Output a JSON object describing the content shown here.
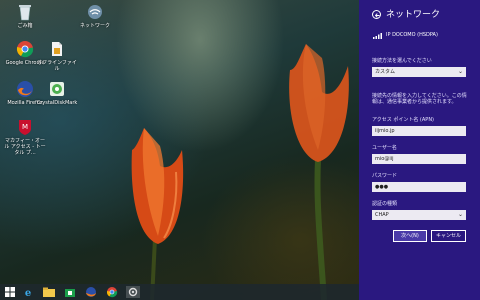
{
  "desktop": {
    "icons": [
      {
        "label": "ごみ箱",
        "icon": "recycle-bin-icon"
      },
      {
        "label": "Google Chrome",
        "icon": "chrome-icon"
      },
      {
        "label": "Mozilla Firefox",
        "icon": "firefox-icon"
      },
      {
        "label": "マカフィー・オール アクセス - トータル プ...",
        "icon": "mcafee-icon"
      },
      {
        "label": "ネットワーク",
        "icon": "network-icon"
      },
      {
        "label": "オフラインファイル",
        "icon": "offline-file-icon"
      },
      {
        "label": "CrystalDiskMark",
        "icon": "crystaldiskmark-icon"
      }
    ]
  },
  "taskbar": {
    "items": [
      "start-icon",
      "ie-icon",
      "explorer-icon",
      "store-icon",
      "firefox-icon",
      "chrome-icon",
      "settings-icon"
    ]
  },
  "panel": {
    "title": "ネットワーク",
    "network_name": "IP DOCOMO (HSDPA)",
    "connect_method_label": "接続方法を選んでください",
    "connect_method_value": "カスタム",
    "note": "接続先の情報を入力してください。この情報は、通信事業者から提供されます。",
    "apn_label": "アクセス ポイント名 (APN)",
    "apn_value": "iijmio.jp",
    "user_label": "ユーザー名",
    "user_value": "mio@iij",
    "password_label": "パスワード",
    "password_value": "●●●",
    "auth_label": "認証の種類",
    "auth_value": "CHAP",
    "next_label": "次へ(N)",
    "cancel_label": "キャンセル"
  },
  "colors": {
    "panel_bg": "#2a1880",
    "input_bg": "#eceaf2"
  }
}
